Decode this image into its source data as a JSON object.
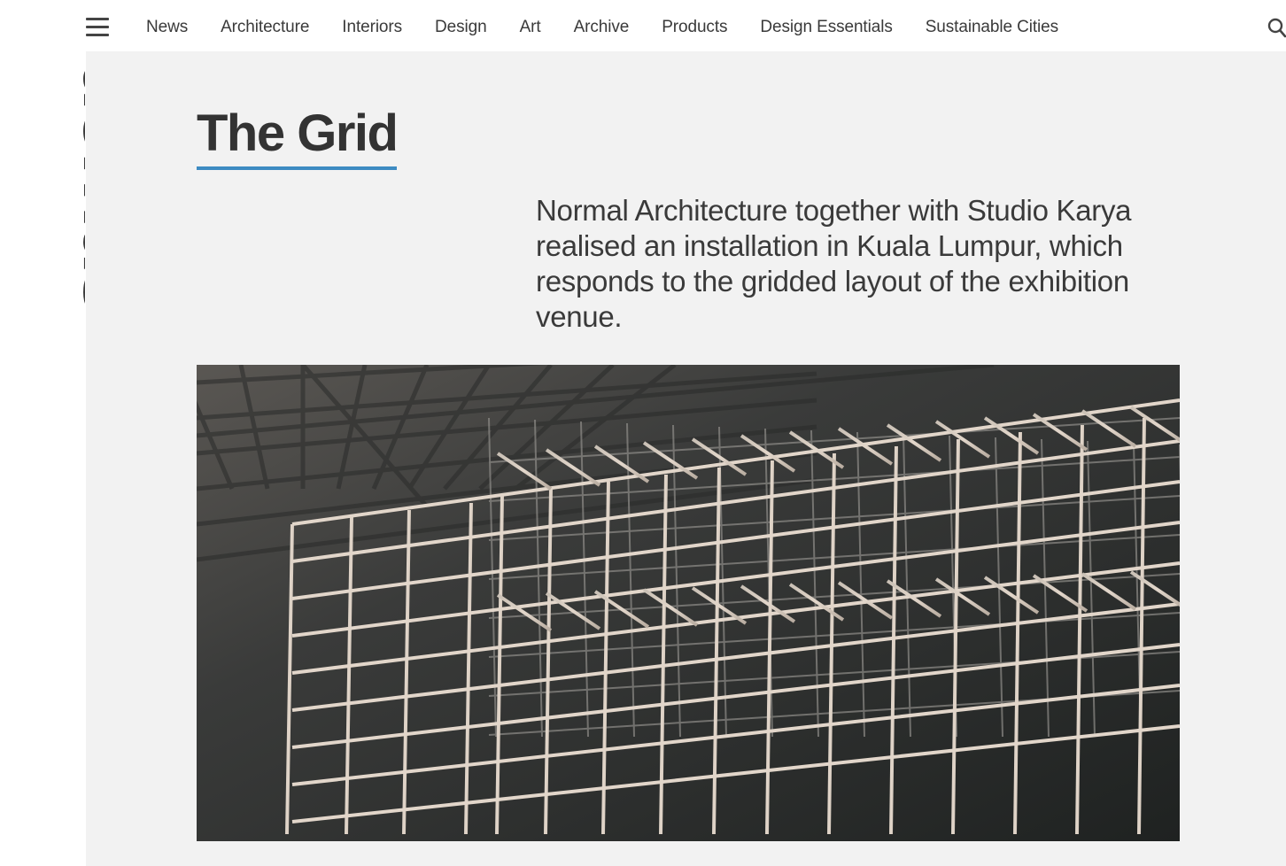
{
  "header": {
    "menu_icon": "hamburger-menu-icon",
    "nav": [
      {
        "label": "News"
      },
      {
        "label": "Architecture"
      },
      {
        "label": "Interiors"
      },
      {
        "label": "Design"
      },
      {
        "label": "Art"
      },
      {
        "label": "Archive"
      },
      {
        "label": "Products"
      },
      {
        "label": "Design Essentials"
      },
      {
        "label": "Sustainable Cities"
      }
    ],
    "search_icon": "search-icon"
  },
  "logo": {
    "text": "domus"
  },
  "article": {
    "title": "The Grid",
    "lead": "Normal Architecture together with Studio Karya realised an installation in Kuala Lumpur, which responds to the gridded layout of the exhibition venue."
  },
  "colors": {
    "accent": "#3d8bc2",
    "panel": "#f2f2f2",
    "text": "#333333"
  }
}
